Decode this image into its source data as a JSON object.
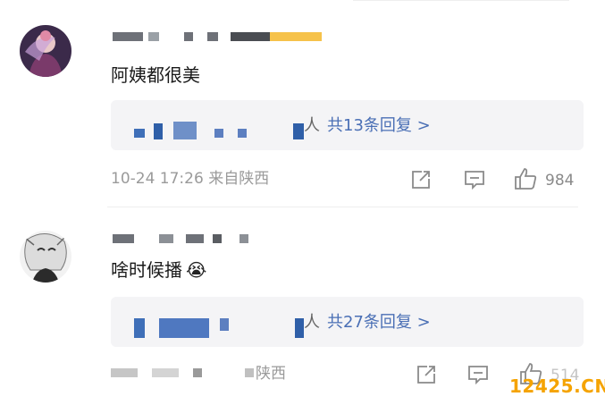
{
  "comments": [
    {
      "text": "阿姨都很美",
      "reply_prefix": "人",
      "reply_link": "共13条回复 >",
      "meta": "10-24 17:26 来自陕西",
      "like_count": "984"
    },
    {
      "text": "啥时候播",
      "emoji": "😭",
      "reply_prefix": "人",
      "reply_link": "共27条回复 >",
      "meta": "陕西",
      "like_count": "514"
    }
  ],
  "watermark": "12425.CN",
  "icons": [
    "share-icon",
    "comment-icon",
    "like-icon"
  ],
  "colors": {
    "link": "#4a6fb5",
    "meta": "#9a9a9a",
    "watermark": "#f5a300"
  }
}
